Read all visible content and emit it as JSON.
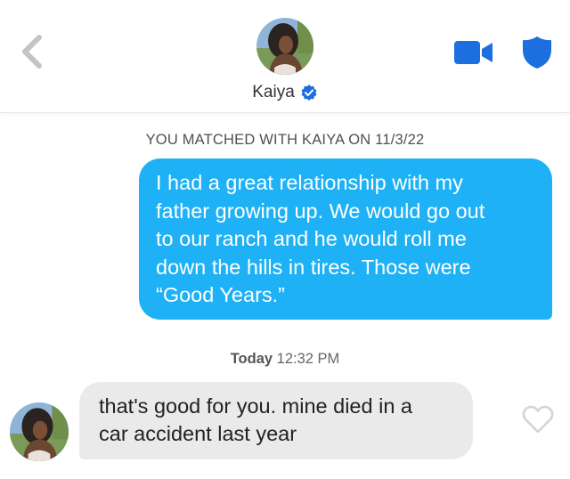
{
  "header": {
    "match_name": "Kaiya",
    "icons": {
      "back": "chevron-left-icon",
      "video": "video-camera-icon",
      "safety": "shield-icon",
      "verified": "verified-badge-icon"
    },
    "accent_color": "#1d6fe0"
  },
  "conversation": {
    "match_notice": "YOU MATCHED WITH KAIYA ON 11/3/22",
    "sent_message": {
      "lines": [
        "I had a great relationship with my",
        "father growing up. We would go out",
        "to our ranch and he would roll me",
        "down the hills in tires. Those were",
        "“Good Years.”"
      ],
      "color": "#1eb1f5"
    },
    "timestamp": {
      "day": "Today",
      "time": "12:32 PM"
    },
    "received_message": {
      "lines": [
        "that's good for you. mine died in a",
        "car accident last year"
      ],
      "color": "#eaeaea",
      "like_icon": "heart-outline-icon"
    }
  }
}
